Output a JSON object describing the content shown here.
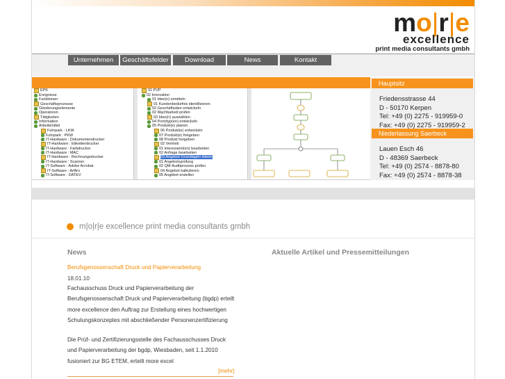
{
  "logo": {
    "main_a": "m",
    "main_o": "o",
    "main_r": "r",
    "main_e": "e",
    "bar": "|",
    "sub": "excellence",
    "tag": "print media consultants gmbh"
  },
  "nav": {
    "items": [
      {
        "label": "Unternehmen"
      },
      {
        "label": "Geschäftsfelder"
      },
      {
        "label": "Download"
      },
      {
        "label": "News"
      },
      {
        "label": "Kontakt"
      }
    ]
  },
  "screenshot": {
    "tree_left": [
      "EPK",
      "Ereignisse",
      "Funktionen",
      "Geschäftsprozesse",
      "Gliederungselemente",
      "Operatoren",
      "Tätigkeiten",
      "Information",
      "Arbeitsmittel",
      "Fuhrpark : LKW",
      "Fuhrpark : PKW",
      "IT-Hardware : Dokumentendrucker",
      "IT-Hardware : Etikettendrucker",
      "IT-Hardware : Farbdrucker",
      "IT-Hardware : MAC",
      "IT-Hardware : Rechnungsdrucker",
      "IT-Hardware : Scanner",
      "IT-Software : Adobe Acrobat",
      "IT-Software : Artfiro",
      "IT-Software : DATEV"
    ],
    "tree_right": [
      "01 PVP",
      "02 Innovation",
      "01 Idee(n) ermitteln",
      "01 Kundenbedürfnis identifizieren",
      "02 Geschäftsidee entwickeln",
      "02 Machbarkeit prüfen",
      "03 Idee(n) auswählen",
      "04 Prototyp(en) entwickeln",
      "05 Produkt(e) planen",
      "06 Produkt(e) entwickeln",
      "07 Produkt(e) freigeben",
      "08 Produkt freigeben",
      "02 Vertrieb",
      "01 Interessent(en) bearbeiten",
      "02 Anfrage bearbeiten",
      "03 Angebot Grundlagen klären",
      "01 Angebotsprüfung",
      "02 QM-Auditprozess prüfen",
      "04 Angebot kalkulieren",
      "05 Angebot erstellen"
    ]
  },
  "contact": {
    "head1": "Hauptsitz",
    "lines1": [
      "Friedensstrasse 44",
      "D - 50170 Kerpen",
      "Tel: +49 (0) 2275 - 919959-0",
      "Fax: +49 (0) 2275 - 919959-2"
    ],
    "head2": "Niederlassung Saerbeck",
    "lines2": [
      "Lauen Esch 46",
      "D - 48369 Saerbeck",
      "Tel: +49 (0) 2574 - 8878-80",
      "Fax: +49 (0) 2574 - 8878-38"
    ]
  },
  "company": "m|o|r|e excellence print media consultants gmbh",
  "news": {
    "heading": "News",
    "link": "Berufsgenossenschaft Druck und Papierverarbeitung",
    "date": "18.01.10",
    "para1": [
      "Fachausschuss Druck und Papierverarbeitung der",
      "Berufsgenossenschaft Druck und Papierverarbeitung (bgdp) erteilt",
      "more excellence den Auftrag zur Erstellung eines hochwertigen",
      "Schulungskonzeptes mit abschließender Personenzertifizierung"
    ],
    "para2": [
      "Die Prüf- und Zertifizierungsstelle des Fachausschusses Druck",
      "und Papierverarbeitung der bgdp, Wiesbaden, seit 1.1.2010",
      "fusioniert zur BG ETEM, erteilt more excel"
    ],
    "more": "[mehr]"
  },
  "articles": {
    "heading": "Aktuelle Artikel und Pressemitteilungen"
  },
  "colors": {
    "accent": "#f28c00",
    "nav_bg": "#626262",
    "orange_bar": "#f7931d"
  }
}
